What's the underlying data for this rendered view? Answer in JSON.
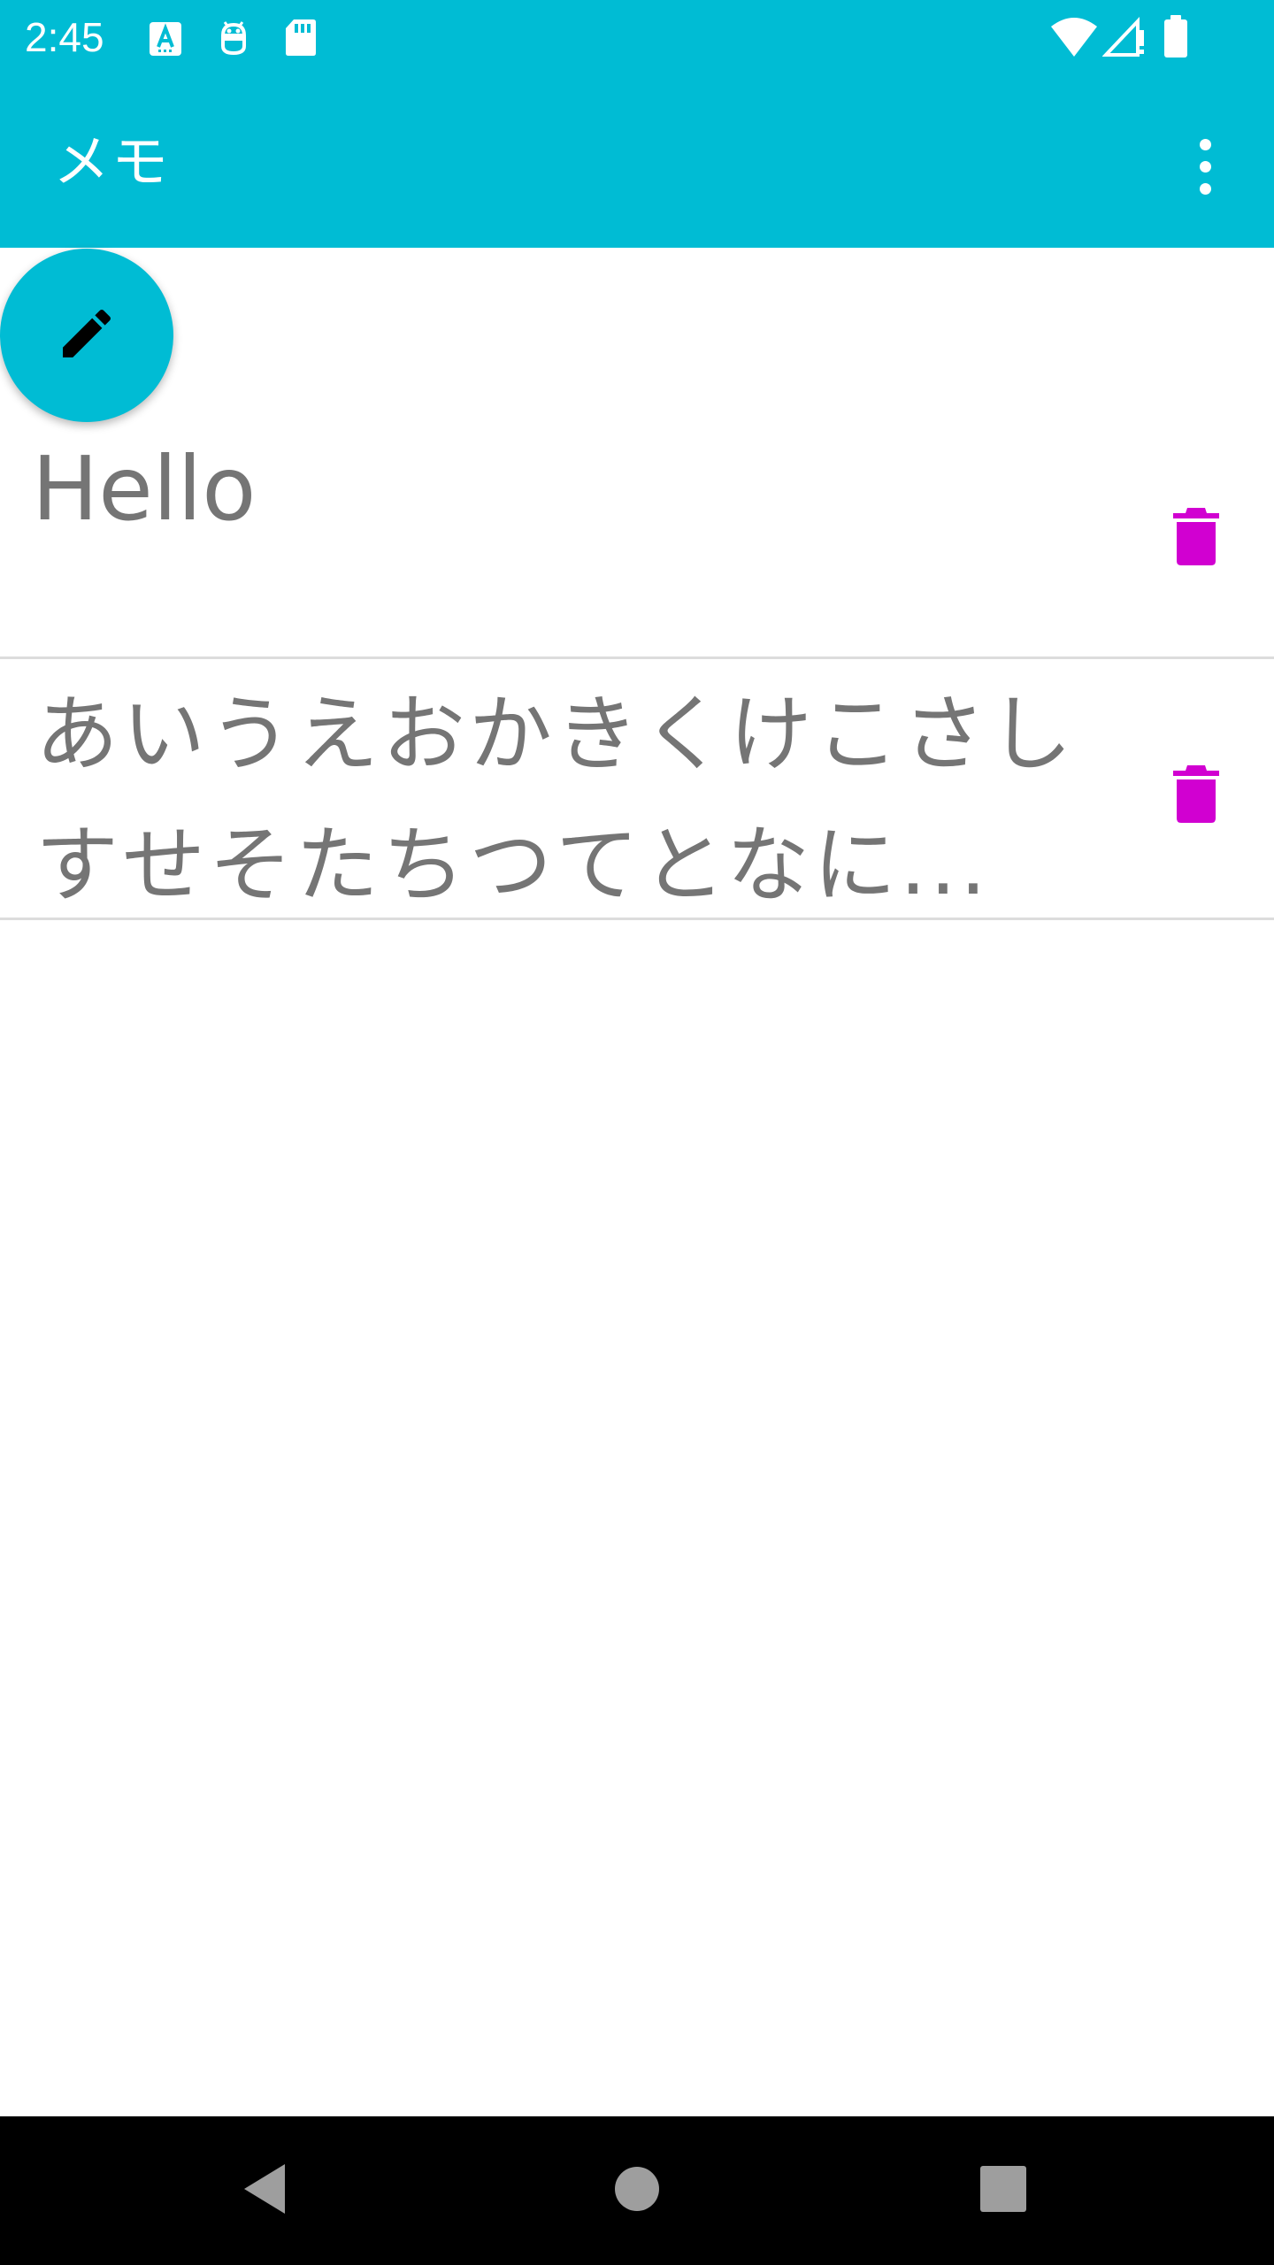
{
  "status_bar": {
    "time": "2:45",
    "icons": [
      "keyboard-a-icon",
      "android-icon",
      "sd-card-icon",
      "wifi-icon",
      "signal-icon",
      "battery-icon"
    ]
  },
  "app_bar": {
    "title": "メモ",
    "overflow_icon": "more-vert-icon",
    "background_color": "#00BCD4"
  },
  "fab": {
    "icon": "pencil-icon",
    "color": "#00BCD4"
  },
  "memos": [
    {
      "text": "Hello",
      "delete_icon": "trash-icon"
    },
    {
      "text": "あいうえおかきくけこさしすせそたちつてとなに...",
      "delete_icon": "trash-icon"
    }
  ],
  "colors": {
    "accent": "#00BCD4",
    "delete": "#D100D1",
    "memo_text": "#757575"
  },
  "nav_bar": {
    "buttons": [
      "back-icon",
      "home-icon",
      "recents-icon"
    ]
  }
}
